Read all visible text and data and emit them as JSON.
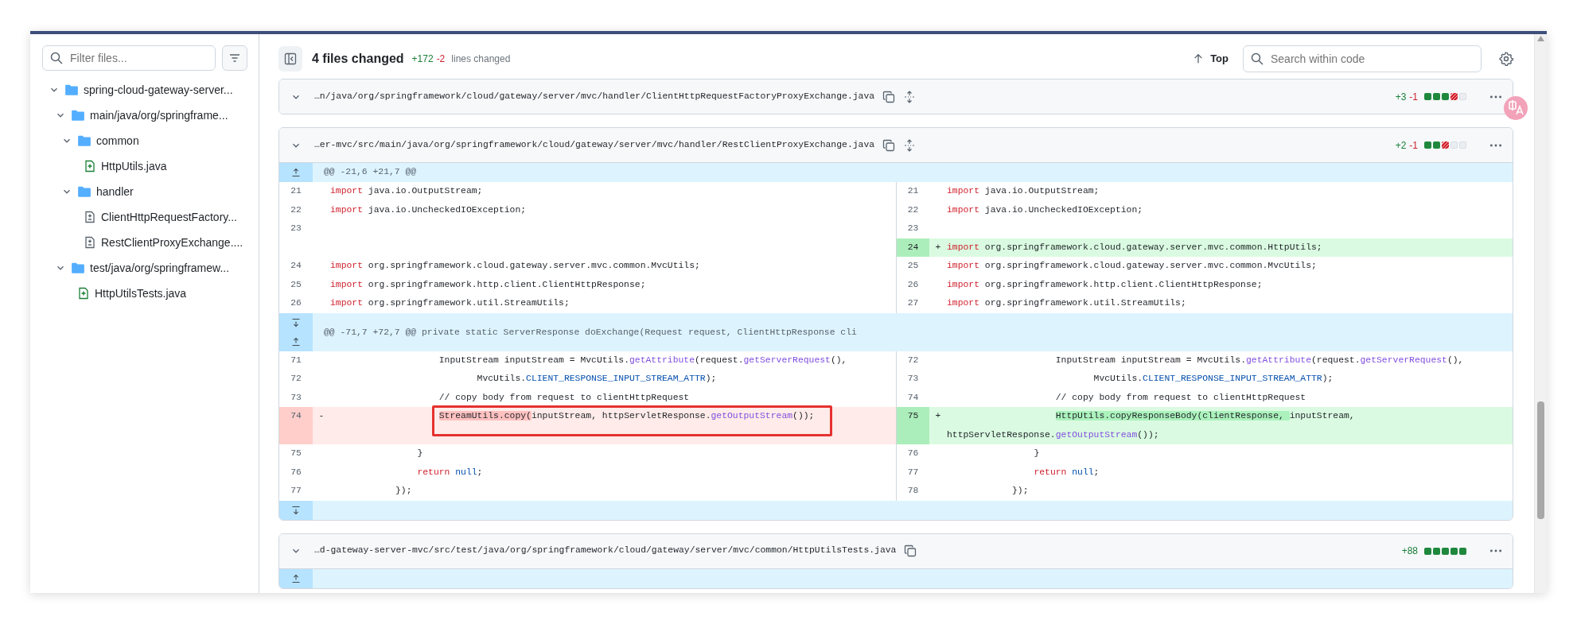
{
  "sidebar": {
    "filter": {
      "placeholder": "Filter files..."
    },
    "tree": [
      {
        "kind": "folder",
        "label": "spring-cloud-gateway-server...",
        "expanded": true,
        "children": [
          {
            "kind": "folder",
            "label": "main/java/org/springframe...",
            "expanded": true,
            "children": [
              {
                "kind": "folder",
                "label": "common",
                "expanded": true,
                "children": [
                  {
                    "kind": "file",
                    "label": "HttpUtils.java",
                    "added": true
                  }
                ]
              },
              {
                "kind": "folder",
                "label": "handler",
                "expanded": true,
                "children": [
                  {
                    "kind": "file",
                    "label": "ClientHttpRequestFactory...",
                    "added": false
                  },
                  {
                    "kind": "file",
                    "label": "RestClientProxyExchange....",
                    "added": false
                  }
                ]
              }
            ]
          },
          {
            "kind": "folder",
            "label": "test/java/org/springframew...",
            "expanded": true,
            "children": [
              {
                "kind": "file",
                "label": "HttpUtilsTests.java",
                "added": true
              }
            ]
          }
        ]
      }
    ]
  },
  "header": {
    "title": "4 files changed",
    "additions": "+172",
    "deletions": "-2",
    "caption": "lines changed",
    "top_link": "Top",
    "search": {
      "placeholder": "Search within code"
    }
  },
  "files": [
    {
      "path": "…n/java/org/springframework/cloud/gateway/server/mvc/handler/ClientHttpRequestFactoryProxyExchange.java",
      "expandable": true,
      "additions": "+3",
      "deletions": "-1",
      "diffstat": [
        {
          "kind": "added"
        },
        {
          "kind": "added"
        },
        {
          "kind": "added"
        },
        {
          "kind": "deleted"
        },
        {
          "kind": "neutral"
        }
      ]
    },
    {
      "path": "…er-mvc/src/main/java/org/springframework/cloud/gateway/server/mvc/handler/RestClientProxyExchange.java",
      "expandable": true,
      "additions": "+2",
      "deletions": "-1",
      "diffstat": [
        {
          "kind": "added"
        },
        {
          "kind": "added"
        },
        {
          "kind": "deleted"
        },
        {
          "kind": "neutral"
        },
        {
          "kind": "neutral"
        }
      ],
      "rows": [
        {
          "kind": "hunk",
          "expand": [
            {
              "kind": "up"
            }
          ],
          "text": "@@ -21,6 +21,7 @@"
        },
        {
          "kind": "line",
          "left": {
            "kind": "context",
            "num": "21",
            "tokens": [
              {
                "kind": "keyword",
                "text": "import"
              },
              {
                "kind": "plain",
                "text": " java.io.OutputStream;"
              }
            ]
          },
          "right": {
            "kind": "context",
            "num": "21",
            "tokens": [
              {
                "kind": "keyword",
                "text": "import"
              },
              {
                "kind": "plain",
                "text": " java.io.OutputStream;"
              }
            ]
          }
        },
        {
          "kind": "line",
          "left": {
            "kind": "context",
            "num": "22",
            "tokens": [
              {
                "kind": "keyword",
                "text": "import"
              },
              {
                "kind": "plain",
                "text": " java.io.UncheckedIOException;"
              }
            ]
          },
          "right": {
            "kind": "context",
            "num": "22",
            "tokens": [
              {
                "kind": "keyword",
                "text": "import"
              },
              {
                "kind": "plain",
                "text": " java.io.UncheckedIOException;"
              }
            ]
          }
        },
        {
          "kind": "line",
          "left": {
            "kind": "context",
            "num": "23"
          },
          "right": {
            "kind": "context",
            "num": "23"
          }
        },
        {
          "kind": "line",
          "left": {
            "kind": "empty"
          },
          "right": {
            "kind": "added",
            "num": "24",
            "sign": "+",
            "tokens": [
              {
                "kind": "keyword",
                "text": "import"
              },
              {
                "kind": "plain",
                "text": " org.springframework.cloud.gateway.server.mvc.common.HttpUtils;"
              }
            ]
          }
        },
        {
          "kind": "line",
          "left": {
            "kind": "context",
            "num": "24",
            "tokens": [
              {
                "kind": "keyword",
                "text": "import"
              },
              {
                "kind": "plain",
                "text": " org.springframework.cloud.gateway.server.mvc.common.MvcUtils;"
              }
            ]
          },
          "right": {
            "kind": "context",
            "num": "25",
            "tokens": [
              {
                "kind": "keyword",
                "text": "import"
              },
              {
                "kind": "plain",
                "text": " org.springframework.cloud.gateway.server.mvc.common.MvcUtils;"
              }
            ]
          }
        },
        {
          "kind": "line",
          "left": {
            "kind": "context",
            "num": "25",
            "tokens": [
              {
                "kind": "keyword",
                "text": "import"
              },
              {
                "kind": "plain",
                "text": " org.springframework.http.client.ClientHttpResponse;"
              }
            ]
          },
          "right": {
            "kind": "context",
            "num": "26",
            "tokens": [
              {
                "kind": "keyword",
                "text": "import"
              },
              {
                "kind": "plain",
                "text": " org.springframework.http.client.ClientHttpResponse;"
              }
            ]
          }
        },
        {
          "kind": "line",
          "left": {
            "kind": "context",
            "num": "26",
            "tokens": [
              {
                "kind": "keyword",
                "text": "import"
              },
              {
                "kind": "plain",
                "text": " org.springframework.util.StreamUtils;"
              }
            ]
          },
          "right": {
            "kind": "context",
            "num": "27",
            "tokens": [
              {
                "kind": "keyword",
                "text": "import"
              },
              {
                "kind": "plain",
                "text": " org.springframework.util.StreamUtils;"
              }
            ]
          }
        },
        {
          "kind": "hunk",
          "expand": [
            {
              "kind": "down"
            },
            {
              "kind": "up"
            }
          ],
          "text": "@@ -71,7 +72,7 @@ private static ServerResponse doExchange(Request request, ClientHttpResponse cli"
        },
        {
          "kind": "line",
          "left": {
            "kind": "context",
            "num": "71",
            "tokens": [
              {
                "kind": "plain",
                "text": "                    InputStream inputStream = MvcUtils."
              },
              {
                "kind": "method",
                "text": "getAttribute"
              },
              {
                "kind": "plain",
                "text": "(request."
              },
              {
                "kind": "method",
                "text": "getServerRequest"
              },
              {
                "kind": "plain",
                "text": "(),"
              }
            ]
          },
          "right": {
            "kind": "context",
            "num": "72",
            "tokens": [
              {
                "kind": "plain",
                "text": "                    InputStream inputStream = MvcUtils."
              },
              {
                "kind": "method",
                "text": "getAttribute"
              },
              {
                "kind": "plain",
                "text": "(request."
              },
              {
                "kind": "method",
                "text": "getServerRequest"
              },
              {
                "kind": "plain",
                "text": "(),"
              }
            ]
          }
        },
        {
          "kind": "line",
          "left": {
            "kind": "context",
            "num": "72",
            "tokens": [
              {
                "kind": "plain",
                "text": "                           MvcUtils."
              },
              {
                "kind": "constant",
                "text": "CLIENT_RESPONSE_INPUT_STREAM_ATTR"
              },
              {
                "kind": "plain",
                "text": ");"
              }
            ]
          },
          "right": {
            "kind": "context",
            "num": "73",
            "tokens": [
              {
                "kind": "plain",
                "text": "                           MvcUtils."
              },
              {
                "kind": "constant",
                "text": "CLIENT_RESPONSE_INPUT_STREAM_ATTR"
              },
              {
                "kind": "plain",
                "text": ");"
              }
            ]
          }
        },
        {
          "kind": "line",
          "left": {
            "kind": "context",
            "num": "73",
            "tokens": [
              {
                "kind": "plain",
                "text": "                    // copy body from request to clientHttpRequest"
              }
            ]
          },
          "right": {
            "kind": "context",
            "num": "74",
            "tokens": [
              {
                "kind": "plain",
                "text": "                    // copy body from request to clientHttpRequest"
              }
            ]
          }
        },
        {
          "kind": "line",
          "left": {
            "kind": "deleted",
            "num": "74",
            "sign": "-",
            "boxed": true,
            "tokens": [
              {
                "kind": "plain",
                "text": "                    StreamUtils.copy(",
                "changed": true
              },
              {
                "kind": "plain",
                "text": "inputStream, httpServletResponse."
              },
              {
                "kind": "method",
                "text": "getOutputStream"
              },
              {
                "kind": "plain",
                "text": "());"
              }
            ]
          },
          "right": {
            "kind": "added",
            "num": "75",
            "sign": "+",
            "tokens": [
              {
                "kind": "plain",
                "text": "                    HttpUtils.copyResponseBody(clientResponse, ",
                "changed": true
              },
              {
                "kind": "plain",
                "text": "inputStream, httpServletResponse."
              },
              {
                "kind": "method",
                "text": "getOutputStream"
              },
              {
                "kind": "plain",
                "text": "());"
              }
            ]
          }
        },
        {
          "kind": "line",
          "left": {
            "kind": "context",
            "num": "75",
            "tokens": [
              {
                "kind": "plain",
                "text": "                }"
              }
            ]
          },
          "right": {
            "kind": "context",
            "num": "76",
            "tokens": [
              {
                "kind": "plain",
                "text": "                }"
              }
            ]
          }
        },
        {
          "kind": "line",
          "left": {
            "kind": "context",
            "num": "76",
            "tokens": [
              {
                "kind": "keyword",
                "text": "                return"
              },
              {
                "kind": "constant",
                "text": " null"
              },
              {
                "kind": "plain",
                "text": ";"
              }
            ]
          },
          "right": {
            "kind": "context",
            "num": "77",
            "tokens": [
              {
                "kind": "keyword",
                "text": "                return"
              },
              {
                "kind": "constant",
                "text": " null"
              },
              {
                "kind": "plain",
                "text": ";"
              }
            ]
          }
        },
        {
          "kind": "line",
          "left": {
            "kind": "context",
            "num": "77",
            "tokens": [
              {
                "kind": "plain",
                "text": "            });"
              }
            ]
          },
          "right": {
            "kind": "context",
            "num": "78",
            "tokens": [
              {
                "kind": "plain",
                "text": "            });"
              }
            ]
          }
        },
        {
          "kind": "hunk",
          "expand": [
            {
              "kind": "down"
            }
          ]
        }
      ]
    },
    {
      "path": "…d-gateway-server-mvc/src/test/java/org/springframework/cloud/gateway/server/mvc/common/HttpUtilsTests.java",
      "expandable": false,
      "additions": "+88",
      "diffstat": [
        {
          "kind": "added"
        },
        {
          "kind": "added"
        },
        {
          "kind": "added"
        },
        {
          "kind": "added"
        },
        {
          "kind": "added"
        }
      ],
      "rows": [
        {
          "kind": "hunk",
          "expand": [
            {
              "kind": "up"
            }
          ]
        }
      ]
    }
  ]
}
